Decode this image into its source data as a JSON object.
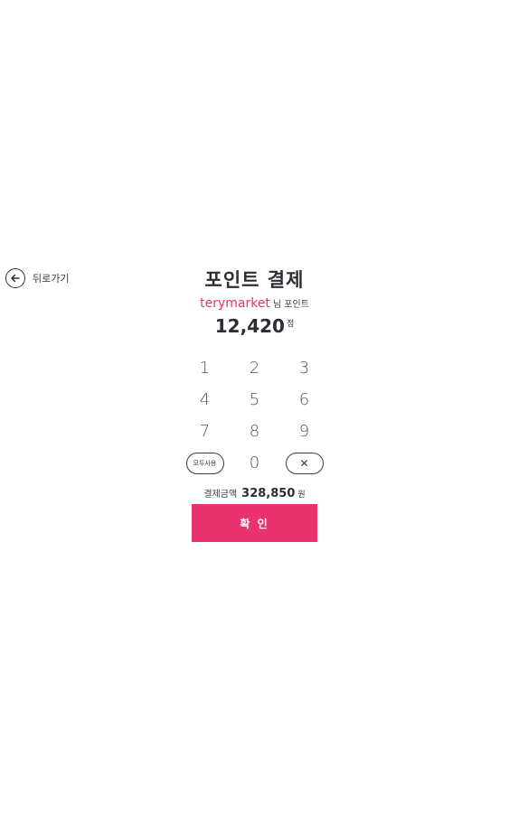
{
  "back": {
    "label": "뒤로가기",
    "icon": "arrow-left-icon"
  },
  "title": "포인트 결제",
  "user": {
    "name": "terymarket",
    "suffix": "님 포인트"
  },
  "points": {
    "value": "12,420",
    "unit": "점"
  },
  "keypad": {
    "keys": [
      "1",
      "2",
      "3",
      "4",
      "5",
      "6",
      "7",
      "8",
      "9"
    ],
    "use_all": "모두사용",
    "zero": "0",
    "clear": "✕"
  },
  "payment": {
    "label": "결제금액",
    "amount": "328,850",
    "currency": "원"
  },
  "confirm_label": "확 인",
  "colors": {
    "accent": "#e8336e",
    "text": "#2c2e34"
  }
}
